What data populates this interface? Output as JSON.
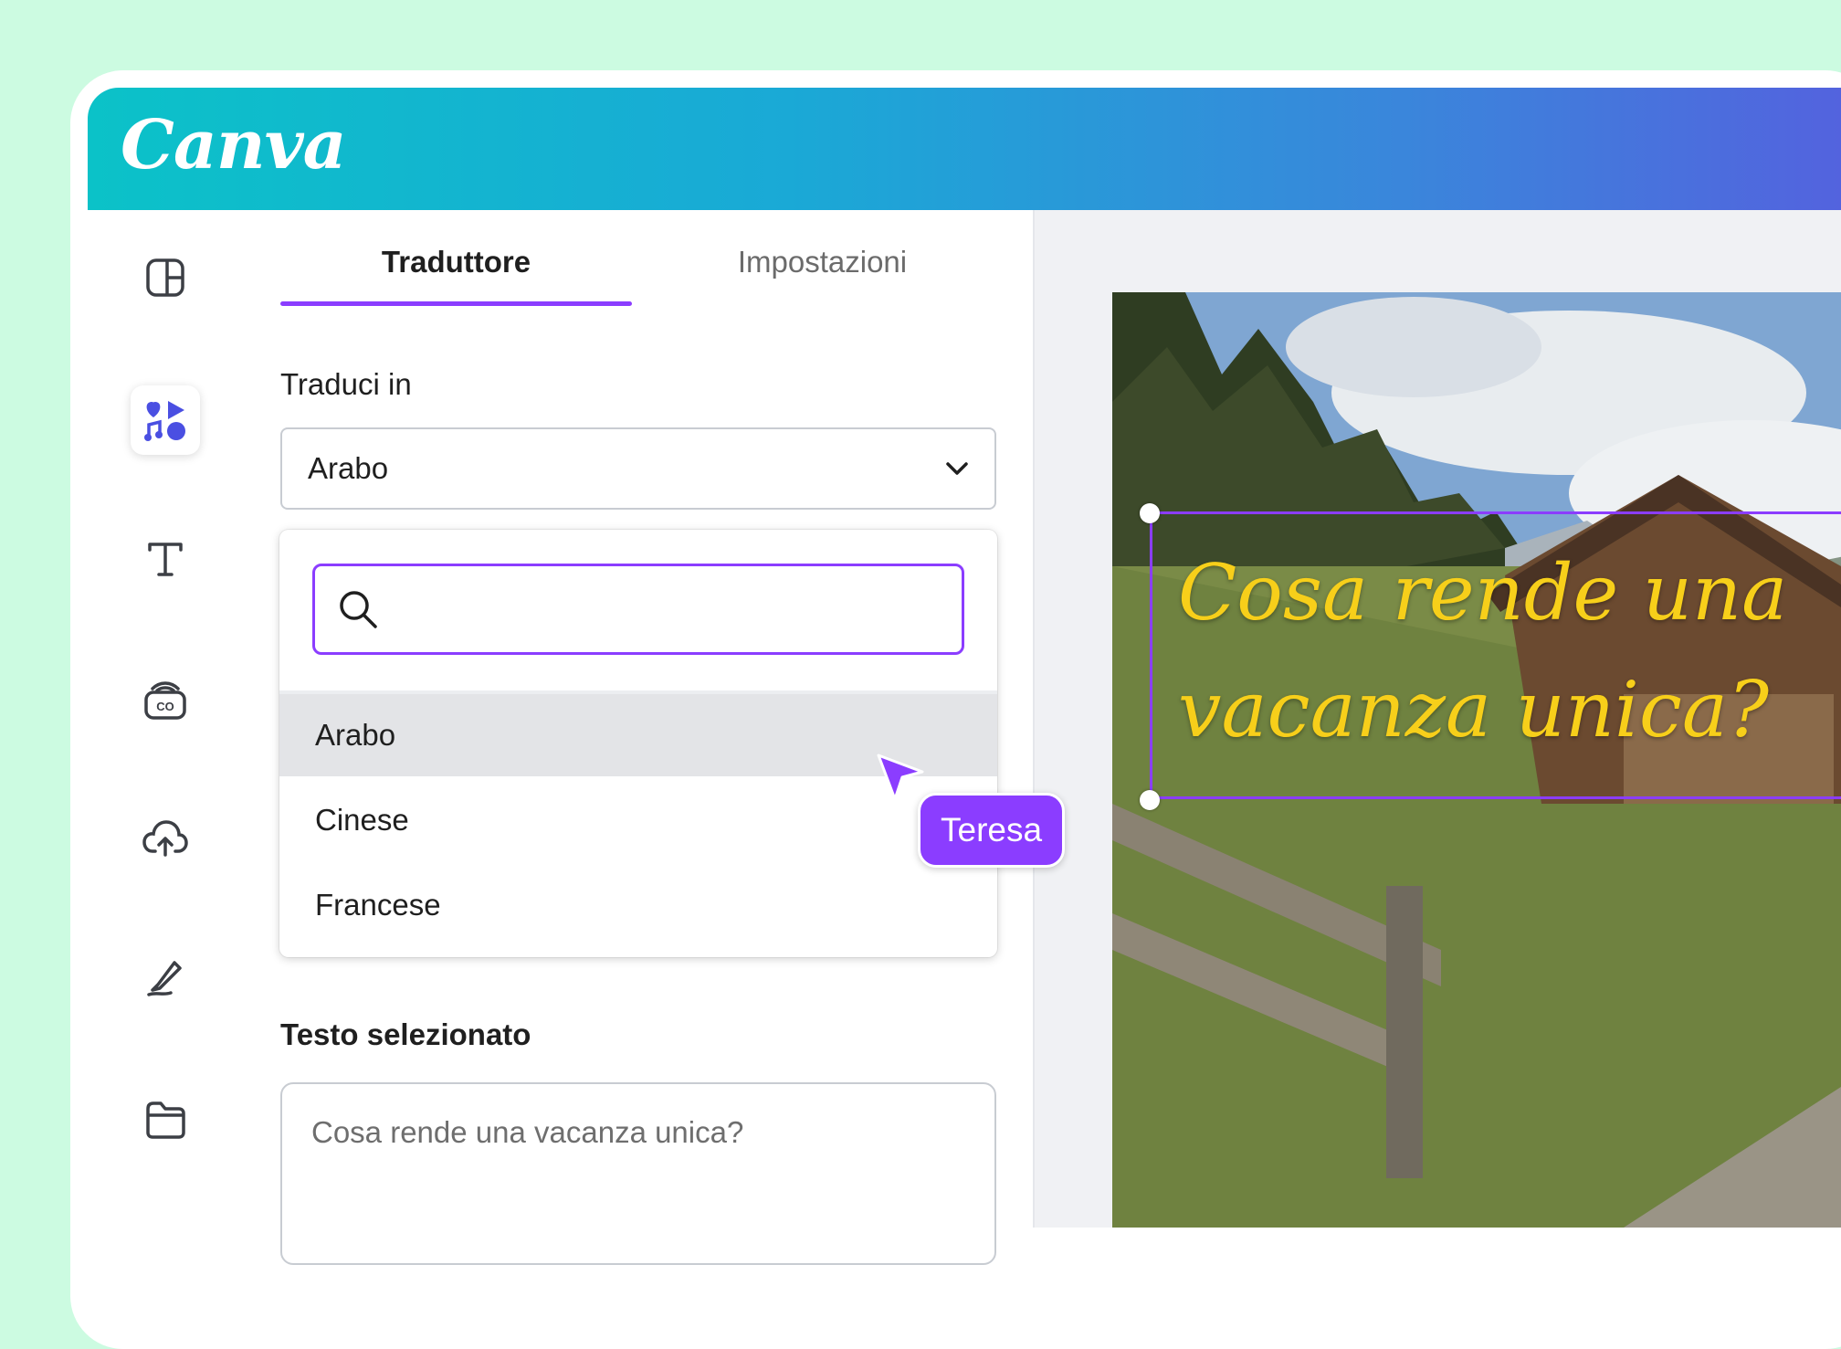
{
  "app": {
    "logo": "Canva"
  },
  "sidebar": {
    "items": [
      {
        "icon": "layout-icon"
      },
      {
        "icon": "apps-icon",
        "active": true
      },
      {
        "icon": "text-icon"
      },
      {
        "icon": "captions-icon"
      },
      {
        "icon": "upload-cloud-icon"
      },
      {
        "icon": "draw-icon"
      },
      {
        "icon": "folder-icon"
      }
    ]
  },
  "panel": {
    "tabs": [
      {
        "label": "Traduttore",
        "active": true
      },
      {
        "label": "Impostazioni",
        "active": false
      }
    ],
    "translate_label": "Traduci in",
    "selected_language": "Arabo",
    "search_placeholder": "",
    "options": [
      "Arabo",
      "Cinese",
      "Francese"
    ],
    "highlighted_option": "Arabo",
    "selected_text_label": "Testo selezionato",
    "selected_text_value": "Cosa rende una vacanza unica?"
  },
  "collaborator": {
    "name": "Teresa",
    "color": "#8b3dff"
  },
  "canvas": {
    "text_lines": [
      "Cosa rende una",
      "vacanza unica?"
    ],
    "text_color": "#f7cf1a"
  },
  "colors": {
    "accent": "#8b3dff",
    "background": "#ccfbe1"
  }
}
